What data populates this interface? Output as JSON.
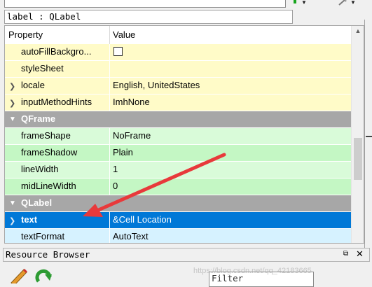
{
  "object_label": "label : QLabel",
  "property_editor": {
    "header": {
      "property": "Property",
      "value": "Value"
    },
    "rows": [
      {
        "kind": "prop",
        "color": "yellow",
        "name": "autoFillBackgro...",
        "value": "",
        "checkbox": true,
        "checked": false
      },
      {
        "kind": "prop",
        "color": "yellow",
        "name": "styleSheet",
        "value": ""
      },
      {
        "kind": "prop",
        "color": "yellow",
        "name": "locale",
        "value": "English, UnitedStates",
        "expandable": true
      },
      {
        "kind": "prop",
        "color": "yellow",
        "name": "inputMethodHints",
        "value": "ImhNone",
        "expandable": true
      },
      {
        "kind": "category",
        "name": "QFrame"
      },
      {
        "kind": "prop",
        "color": "green",
        "name": "frameShape",
        "value": "NoFrame"
      },
      {
        "kind": "prop",
        "color": "green2",
        "name": "frameShadow",
        "value": "Plain"
      },
      {
        "kind": "prop",
        "color": "green",
        "name": "lineWidth",
        "value": "1"
      },
      {
        "kind": "prop",
        "color": "green2",
        "name": "midLineWidth",
        "value": "0"
      },
      {
        "kind": "category",
        "name": "QLabel"
      },
      {
        "kind": "prop",
        "color": "selected",
        "name": "text",
        "value": "&Cell Location",
        "expandable": true
      },
      {
        "kind": "prop",
        "color": "blue",
        "name": "textFormat",
        "value": "AutoText"
      }
    ]
  },
  "resource_browser": {
    "title": "Resource Browser",
    "float_label": "⧉",
    "close_label": "✕",
    "filter_placeholder": "Filter"
  },
  "watermark": "https://blog.csdn.net/qq_42183665",
  "colors": {
    "yellow": "#fffbc8",
    "green": "#d9fbd9",
    "green2": "#c4f7c4",
    "blue": "#d6f2ff",
    "selected": "#0078d7",
    "category": "#a7a7a7",
    "arrow": "#e8393b"
  },
  "icons": [
    "tool-icon",
    "pencil-icon",
    "reload-icon"
  ]
}
